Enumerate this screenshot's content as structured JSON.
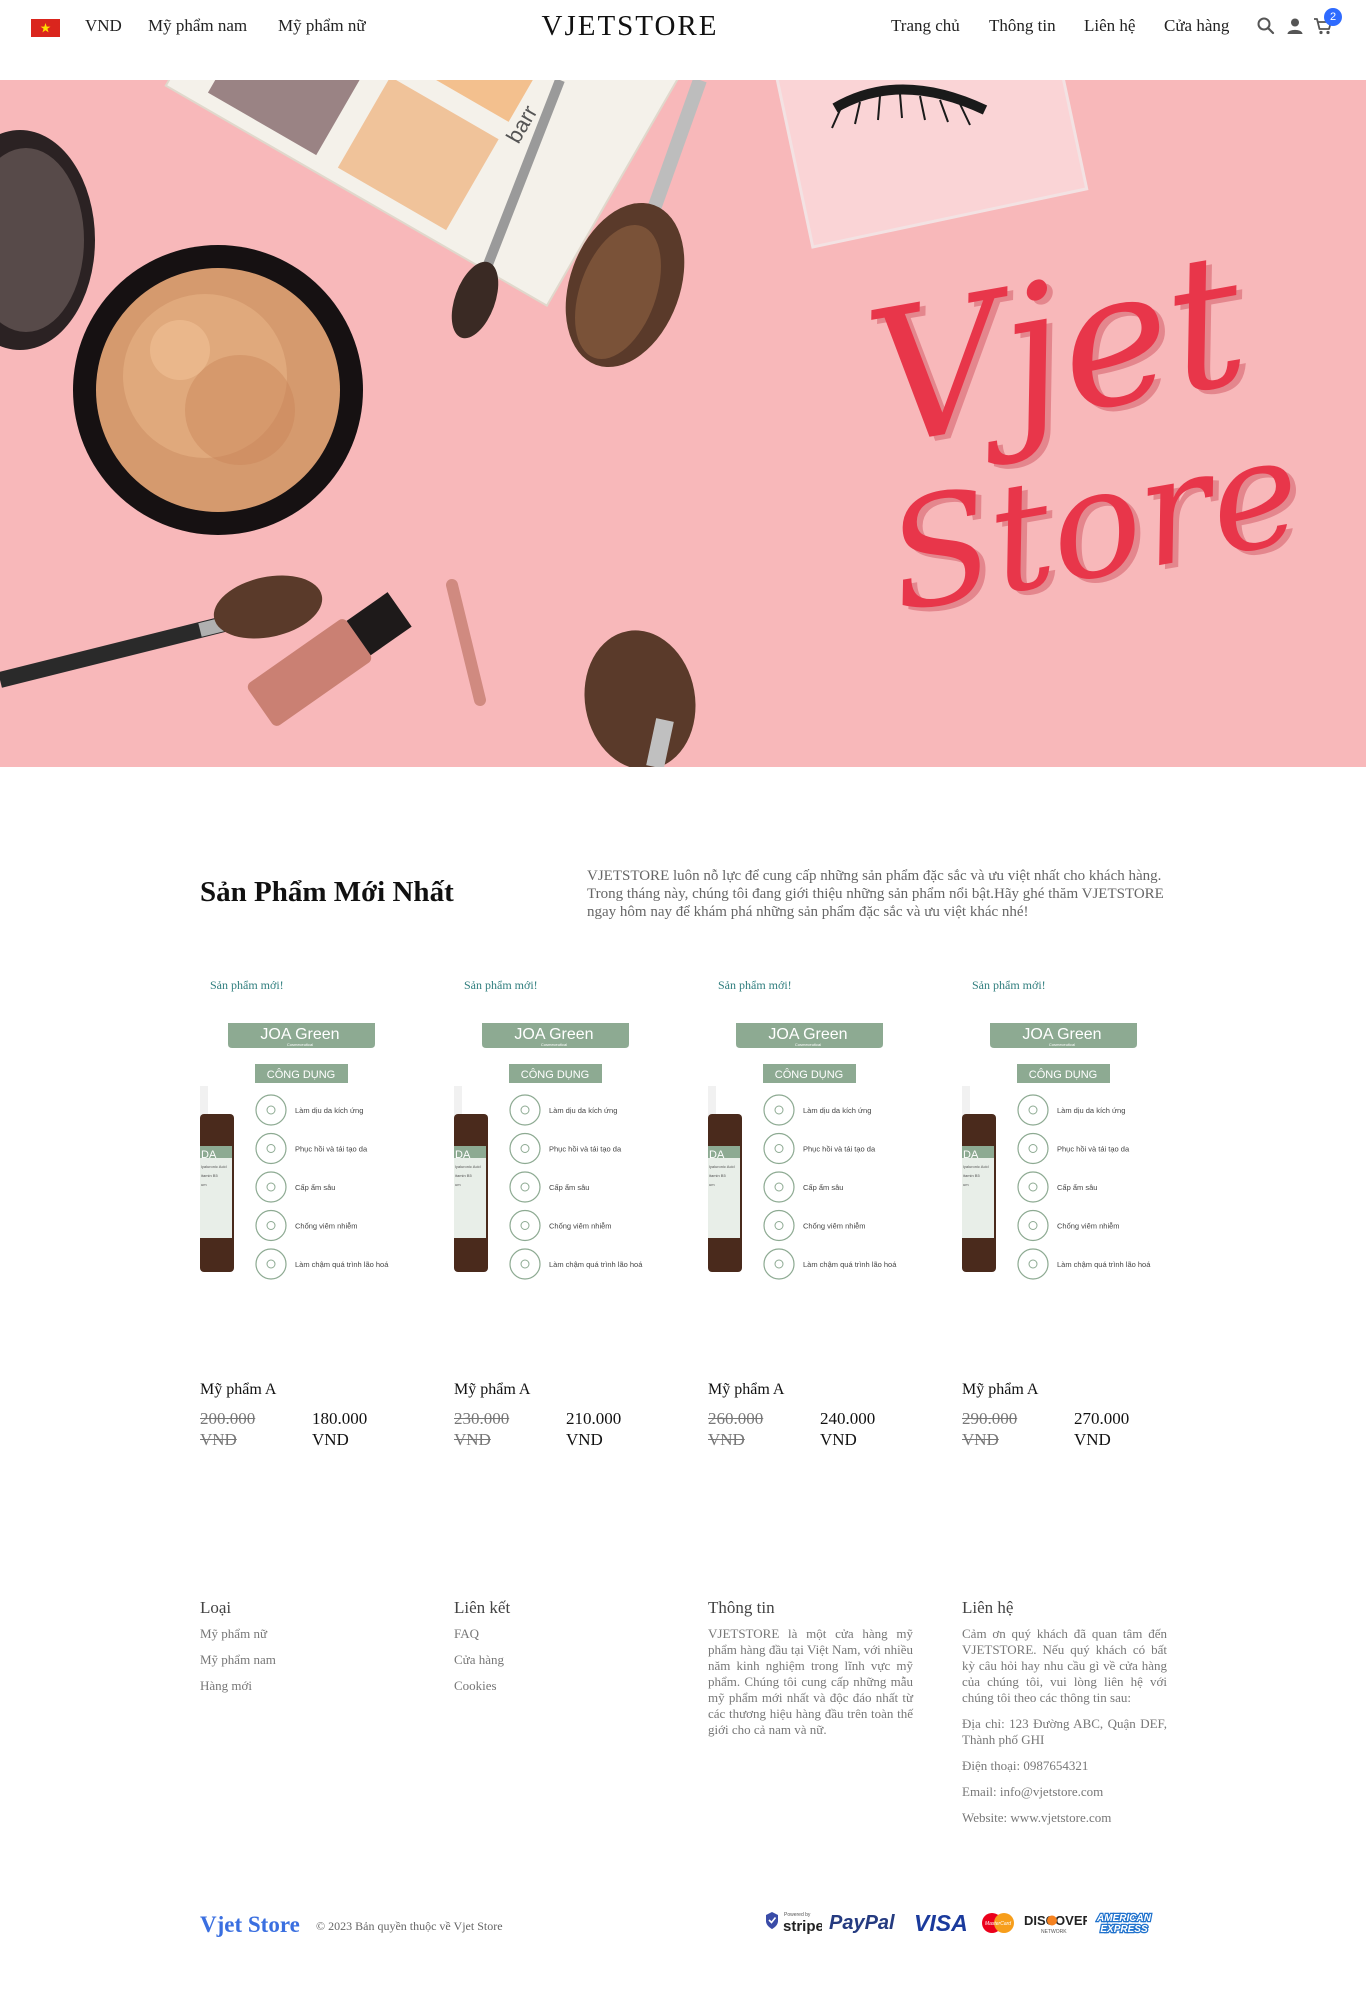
{
  "header": {
    "currency": "VND",
    "nav_left": [
      "Mỹ phẩm nam",
      "Mỹ phẩm nữ"
    ],
    "logo": "VJETSTORE",
    "nav_right": [
      "Trang chủ",
      "Thông tin",
      "Liên hệ",
      "Cửa hàng"
    ],
    "cart_count": "2",
    "icons": [
      "vietnam-flag-icon",
      "search-icon",
      "user-icon",
      "cart-icon"
    ]
  },
  "hero": {
    "script_line_1": "Vjet",
    "script_line_2": "Store",
    "palette_brand": "barr",
    "accent_color": "#e8364a",
    "background_color": "#f8b8ba"
  },
  "intro": {
    "title": "Sản Phẩm Mới Nhất",
    "description": "VJETSTORE luôn nỗ lực để cung cấp những sản phẩm đặc sắc và ưu việt nhất cho khách hàng. Trong tháng này, chúng tôi đang giới thiệu những sản phẩm nổi bật.Hãy ghé thăm VJETSTORE ngay hôm nay để khám phá những sản phẩm đặc sắc và ưu việt khác nhé!"
  },
  "product_card": {
    "label_brand": "JOA Green",
    "label_sub": "Cosmeceutical",
    "label_heading": "CÔNG DỤNG",
    "bottle_text": [
      "DA",
      "lyaluronic Acid",
      "itamin B5",
      "um"
    ],
    "benefits": [
      "Làm dịu da kích ứng",
      "Phục hồi và tái tạo da",
      "Cấp ẩm sâu",
      "Chống viêm nhiễm",
      "Làm chậm quá trình lão hoá"
    ]
  },
  "products": [
    {
      "badge": "Sản phẩm mới!",
      "name": "Mỹ phẩm A",
      "old_price": "200.000 VND",
      "new_price": "180.000 VND"
    },
    {
      "badge": "Sản phẩm mới!",
      "name": "Mỹ phẩm A",
      "old_price": "230.000 VND",
      "new_price": "210.000 VND"
    },
    {
      "badge": "Sản phẩm mới!",
      "name": "Mỹ phẩm A",
      "old_price": "260.000 VND",
      "new_price": "240.000 VND"
    },
    {
      "badge": "Sản phẩm mới!",
      "name": "Mỹ phẩm A",
      "old_price": "290.000 VND",
      "new_price": "270.000 VND"
    }
  ],
  "footer": {
    "categories": {
      "title": "Loại",
      "links": [
        "Mỹ phẩm nữ",
        "Mỹ phẩm nam",
        "Hàng mới"
      ]
    },
    "links": {
      "title": "Liên kết",
      "links": [
        "FAQ",
        "Cửa hàng",
        "Cookies"
      ]
    },
    "info": {
      "title": "Thông tin",
      "text": "VJETSTORE là một cửa hàng mỹ phẩm hàng đầu tại Việt Nam, với nhiều năm kinh nghiệm trong lĩnh vực mỹ phẩm. Chúng tôi cung cấp những mẫu mỹ phẩm mới nhất và độc đáo nhất từ các thương hiệu hàng đầu trên toàn thế giới cho cả nam và nữ."
    },
    "contact": {
      "title": "Liên hệ",
      "text": "Cảm ơn quý khách đã quan tâm đến VJETSTORE. Nếu quý khách có bất kỳ câu hỏi hay nhu cầu gì về cửa hàng của chúng tôi, vui lòng liên hệ với chúng tôi theo các thông tin sau:",
      "address": "Địa chỉ: 123 Đường ABC, Quận DEF, Thành phố GHI",
      "phone": "Điện thoại: 0987654321",
      "email": "Email: info@vjetstore.com",
      "website": "Website: www.vjetstore.com"
    },
    "brand": "Vjet Store",
    "copyright": "© 2023 Bản quyền thuộc về Vjet Store",
    "payments": {
      "stripe_powered": "Powered by",
      "stripe": "stripe",
      "paypal": "PayPal",
      "visa": "VISA",
      "mastercard": "MasterCard",
      "discover": "DISCOVER",
      "discover_sub": "NETWORK",
      "amex_top": "AMERICAN",
      "amex_bottom": "EXPRESS"
    }
  }
}
